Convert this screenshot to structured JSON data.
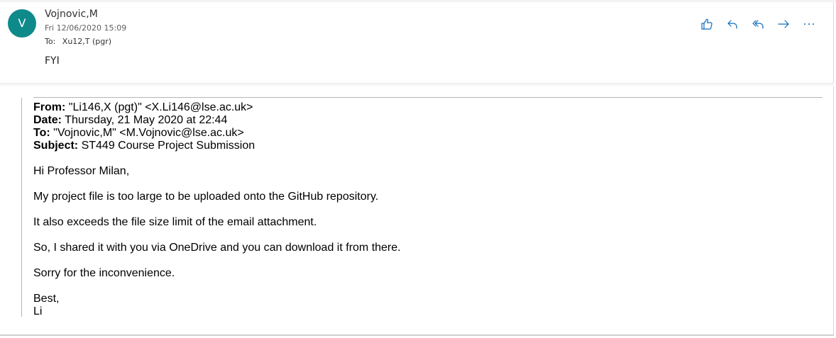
{
  "message": {
    "avatar_initial": "V",
    "sender_name": "Vojnovic,M",
    "datetime": "Fri 12/06/2020 15:09",
    "to_label": "To:",
    "to_value": "Xu12,T (pgr)",
    "body_intro": "FYI"
  },
  "actions": [
    {
      "name": "like",
      "icon": "thumbs-up-icon"
    },
    {
      "name": "reply",
      "icon": "reply-icon"
    },
    {
      "name": "reply-all",
      "icon": "reply-all-icon"
    },
    {
      "name": "forward",
      "icon": "forward-icon"
    },
    {
      "name": "more",
      "icon": "more-icon"
    }
  ],
  "forwarded": {
    "from_label": "From:",
    "from_value": " \"Li146,X (pgt)\" <X.Li146@lse.ac.uk>",
    "date_label": "Date:",
    "date_value": " Thursday, 21 May 2020 at 22:44",
    "to_label": "To:",
    "to_value": " \"Vojnovic,M\" <M.Vojnovic@lse.ac.uk>",
    "subject_label": "Subject:",
    "subject_value": " ST449 Course Project Submission",
    "greeting": "Hi Professor Milan,",
    "paragraphs": [
      "My project file is too large to be uploaded onto the GitHub repository.",
      "It also exceeds the file size limit of the email attachment.",
      "So, I shared it with you via OneDrive and you can download it from there.",
      "Sorry for the inconvenience."
    ],
    "signoff": "Best,",
    "signature": "Li"
  },
  "colors": {
    "avatar_bg": "#0f8a8a",
    "action_icon": "#0f6cbd"
  }
}
